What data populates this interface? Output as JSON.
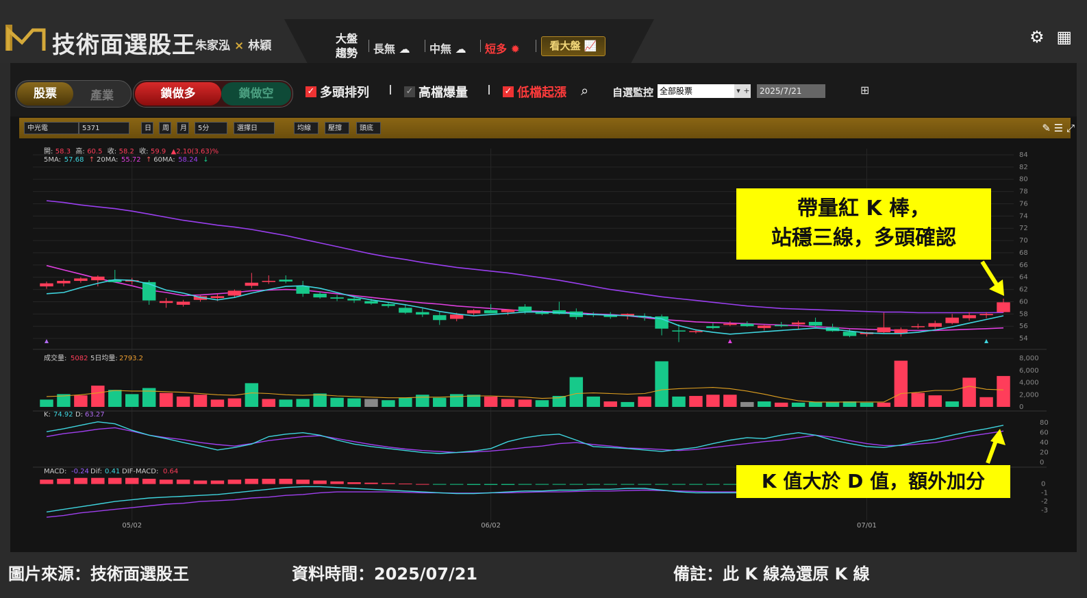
{
  "app": {
    "title": "技術面選股王",
    "author1": "朱家泓",
    "author_sep": "×",
    "author2": "林穎"
  },
  "market": {
    "label_line1": "大盤",
    "label_line2": "趨勢",
    "long": "長無",
    "mid": "中無",
    "short": "短多",
    "button": "看大盤"
  },
  "toolbar": {
    "seg1": [
      "股票",
      "產業"
    ],
    "seg2": [
      "鎖做多",
      "鎖做空"
    ],
    "filters": [
      {
        "label": "多頭排列",
        "checked": true
      },
      {
        "label": "高檔爆量",
        "checked": false
      },
      {
        "label": "低檔起漲",
        "checked": true
      }
    ],
    "watch_label": "自選監控",
    "watch_value": "全部股票",
    "date_value": "2025/7/21"
  },
  "chart_toolbar": {
    "stock_name": "中光電",
    "stock_code": "5371",
    "periods": [
      "日",
      "周",
      "月"
    ],
    "interval": "5分",
    "option": "選擇日",
    "tools": [
      "均線",
      "壓撐",
      "頭底"
    ]
  },
  "info": {
    "o_label": "開:",
    "o": "58.3",
    "h_label": "高:",
    "h": "60.5",
    "l_label": "收:",
    "l": "58.2",
    "c_label": "收:",
    "c": "59.9",
    "chg": "▲2.10(3.63)%",
    "ma5_label": "5MA:",
    "ma5": "57.68",
    "ma20_label": "20MA:",
    "ma20": "55.72",
    "ma60_label": "60MA:",
    "ma60": "58.24",
    "vol_label": "成交量:",
    "vol": "5082",
    "vol5_label": "5日均量:",
    "vol5": "2793.2",
    "k_label": "K:",
    "k": "74.92",
    "d_label": "D:",
    "d": "63.27",
    "macd_label": "MACD:",
    "macd": "-0.24",
    "dif_label": "Dif:",
    "dif": "0.41",
    "difmacd_label": "DIF-MACD:",
    "difmacd": "0.64"
  },
  "colors": {
    "up": "#ff3d5a",
    "down": "#17c98a",
    "ma5": "#3fd6e0",
    "ma20": "#e040e0",
    "ma60": "#9a3ff0",
    "callout": "#ffff00"
  },
  "chart_data": {
    "type": "candlestick",
    "x_ticks": [
      "05/02",
      "06/02",
      "07/01"
    ],
    "price_axis": [
      "84",
      "82",
      "80",
      "78",
      "76",
      "74",
      "72",
      "70",
      "68",
      "66",
      "64",
      "62",
      "60",
      "58",
      "56",
      "54"
    ],
    "price_range": [
      53,
      85
    ],
    "volume_axis": [
      "8,000",
      "6,000",
      "4,000",
      "2,000",
      "0"
    ],
    "volume_range": [
      0,
      8000
    ],
    "kd_axis": [
      "80",
      "60",
      "40",
      "20",
      "0"
    ],
    "macd_axis": [
      "0",
      "-1",
      "-2",
      "-3"
    ],
    "candles": [
      [
        62.5,
        63.3,
        62.1,
        63.0
      ],
      [
        63.0,
        63.7,
        62.5,
        63.4
      ],
      [
        63.4,
        64.0,
        63.1,
        63.8
      ],
      [
        63.5,
        64.3,
        62.5,
        64.1
      ],
      [
        63.6,
        65.2,
        63.1,
        63.2
      ],
      [
        63.3,
        63.9,
        62.8,
        63.5
      ],
      [
        63.2,
        63.5,
        59.5,
        60.2
      ],
      [
        59.8,
        60.6,
        59.0,
        60.1
      ],
      [
        59.5,
        60.3,
        59.2,
        60.0
      ],
      [
        60.3,
        61.0,
        60.0,
        60.9
      ],
      [
        60.6,
        61.3,
        60.1,
        60.9
      ],
      [
        61.0,
        62.0,
        60.7,
        61.8
      ],
      [
        62.6,
        64.7,
        62.2,
        63.1
      ],
      [
        63.3,
        64.3,
        62.9,
        63.4
      ],
      [
        63.6,
        64.3,
        63.0,
        63.3
      ],
      [
        62.5,
        63.4,
        60.8,
        61.3
      ],
      [
        61.3,
        61.6,
        60.5,
        60.7
      ],
      [
        60.7,
        61.1,
        60.1,
        60.5
      ],
      [
        60.5,
        60.9,
        59.8,
        60.2
      ],
      [
        60.1,
        60.5,
        59.5,
        59.7
      ],
      [
        59.6,
        60.0,
        59.0,
        59.3
      ],
      [
        59.0,
        59.5,
        58.0,
        58.2
      ],
      [
        58.3,
        58.9,
        57.5,
        57.9
      ],
      [
        57.8,
        58.3,
        56.2,
        57.0
      ],
      [
        57.2,
        58.2,
        56.8,
        57.9
      ],
      [
        58.1,
        58.8,
        57.8,
        58.6
      ],
      [
        58.6,
        59.6,
        58.1,
        58.1
      ],
      [
        58.3,
        58.8,
        57.8,
        58.7
      ],
      [
        59.2,
        59.6,
        58.0,
        58.4
      ],
      [
        58.2,
        58.6,
        57.8,
        58.0
      ],
      [
        58.6,
        60.0,
        57.9,
        58.0
      ],
      [
        58.4,
        58.9,
        57.1,
        57.5
      ],
      [
        58.0,
        58.3,
        57.5,
        57.8
      ],
      [
        57.8,
        58.3,
        57.2,
        57.5
      ],
      [
        57.7,
        58.1,
        57.1,
        58.0
      ],
      [
        57.6,
        58.1,
        56.9,
        57.5
      ],
      [
        57.6,
        57.9,
        54.5,
        55.6
      ],
      [
        55.3,
        56.3,
        53.4,
        55.2
      ],
      [
        55.1,
        55.5,
        54.8,
        55.2
      ],
      [
        56.0,
        56.5,
        55.5,
        55.7
      ],
      [
        56.2,
        56.8,
        56.0,
        56.4
      ],
      [
        56.4,
        56.8,
        55.9,
        56.0
      ],
      [
        55.7,
        56.2,
        55.3,
        56.1
      ],
      [
        56.2,
        56.7,
        55.8,
        56.0
      ],
      [
        56.3,
        56.9,
        55.4,
        56.6
      ],
      [
        56.7,
        57.4,
        55.8,
        56.1
      ],
      [
        55.8,
        56.4,
        55.1,
        55.2
      ],
      [
        55.1,
        55.5,
        54.2,
        54.4
      ],
      [
        54.7,
        55.1,
        54.3,
        55.0
      ],
      [
        55.0,
        58.2,
        54.9,
        55.8
      ],
      [
        54.8,
        55.8,
        54.3,
        55.5
      ],
      [
        56.0,
        56.4,
        55.6,
        56.0
      ],
      [
        55.9,
        56.9,
        55.5,
        56.5
      ],
      [
        56.5,
        58.0,
        56.3,
        57.4
      ],
      [
        57.3,
        58.3,
        56.9,
        57.8
      ],
      [
        57.8,
        58.3,
        57.3,
        58.0
      ],
      [
        58.3,
        60.5,
        58.2,
        59.9
      ]
    ],
    "volume": [
      [
        1200,
        "d"
      ],
      [
        2100,
        "d"
      ],
      [
        1900,
        "u"
      ],
      [
        3500,
        "u"
      ],
      [
        2800,
        "d"
      ],
      [
        2100,
        "d"
      ],
      [
        3100,
        "d"
      ],
      [
        2300,
        "u"
      ],
      [
        1700,
        "u"
      ],
      [
        2000,
        "u"
      ],
      [
        1200,
        "u"
      ],
      [
        1400,
        "u"
      ],
      [
        3900,
        "d"
      ],
      [
        1300,
        "u"
      ],
      [
        1200,
        "d"
      ],
      [
        1300,
        "d"
      ],
      [
        2200,
        "d"
      ],
      [
        1500,
        "d"
      ],
      [
        1400,
        "d"
      ],
      [
        1300,
        "g"
      ],
      [
        1100,
        "d"
      ],
      [
        1500,
        "d"
      ],
      [
        2000,
        "d"
      ],
      [
        1500,
        "d"
      ],
      [
        2100,
        "d"
      ],
      [
        2000,
        "d"
      ],
      [
        1700,
        "u"
      ],
      [
        1300,
        "u"
      ],
      [
        1200,
        "u"
      ],
      [
        1100,
        "d"
      ],
      [
        1800,
        "d"
      ],
      [
        4900,
        "d"
      ],
      [
        1700,
        "d"
      ],
      [
        900,
        "u"
      ],
      [
        800,
        "d"
      ],
      [
        1700,
        "u"
      ],
      [
        7500,
        "d"
      ],
      [
        1700,
        "d"
      ],
      [
        1800,
        "u"
      ],
      [
        2000,
        "u"
      ],
      [
        2000,
        "u"
      ],
      [
        800,
        "g"
      ],
      [
        900,
        "d"
      ],
      [
        700,
        "u"
      ],
      [
        700,
        "d"
      ],
      [
        800,
        "d"
      ],
      [
        800,
        "d"
      ],
      [
        900,
        "d"
      ],
      [
        700,
        "d"
      ],
      [
        700,
        "u"
      ],
      [
        7600,
        "u"
      ],
      [
        2300,
        "u"
      ],
      [
        1900,
        "u"
      ],
      [
        900,
        "d"
      ],
      [
        4800,
        "u"
      ],
      [
        1600,
        "u"
      ],
      [
        5082,
        "u"
      ]
    ],
    "ma5": [
      61.3,
      61.5,
      62.3,
      63.0,
      63.6,
      63.5,
      62.9,
      61.9,
      61.4,
      60.7,
      60.3,
      60.7,
      61.4,
      62.0,
      62.5,
      62.6,
      62.2,
      61.5,
      60.8,
      60.3,
      59.9,
      59.5,
      59.0,
      58.4,
      58.0,
      57.7,
      57.9,
      58.1,
      58.3,
      58.3,
      58.2,
      58.0,
      57.9,
      57.8,
      57.7,
      57.6,
      57.2,
      56.1,
      55.4,
      55.0,
      54.7,
      54.9,
      55.1,
      55.3,
      55.5,
      55.7,
      55.5,
      55.2,
      54.9,
      54.8,
      54.8,
      55.0,
      55.4,
      55.9,
      56.5,
      57.1,
      57.7
    ],
    "ma20": [
      65.9,
      65.2,
      64.5,
      63.8,
      63.2,
      62.6,
      61.9,
      61.5,
      61.0,
      61.1,
      61.3,
      61.5,
      61.8,
      61.9,
      62.0,
      61.9,
      61.6,
      61.3,
      61.0,
      60.7,
      60.4,
      60.1,
      59.8,
      59.6,
      59.3,
      59.1,
      58.9,
      58.7,
      58.5,
      58.4,
      58.3,
      58.2,
      58.0,
      57.9,
      57.7,
      57.4,
      57.1,
      56.9,
      56.7,
      56.6,
      56.5,
      56.4,
      56.3,
      56.2,
      56.1,
      55.9,
      55.8,
      55.6,
      55.5,
      55.4,
      55.3,
      55.3,
      55.3,
      55.4,
      55.5,
      55.6,
      55.72
    ],
    "ma60": [
      76.5,
      76.2,
      75.8,
      75.5,
      75.2,
      74.8,
      74.3,
      73.8,
      73.3,
      72.9,
      72.5,
      72.2,
      71.8,
      71.3,
      70.8,
      70.2,
      69.6,
      69.0,
      68.4,
      67.8,
      67.3,
      66.9,
      66.4,
      66.0,
      65.6,
      65.3,
      65.0,
      64.7,
      64.3,
      63.9,
      63.5,
      63.0,
      62.5,
      62.0,
      61.6,
      61.2,
      60.8,
      60.5,
      60.2,
      59.9,
      59.6,
      59.3,
      59.1,
      58.9,
      58.8,
      58.7,
      58.6,
      58.5,
      58.4,
      58.3,
      58.3,
      58.2,
      58.2,
      58.2,
      58.2,
      58.2,
      58.24
    ],
    "k": [
      62,
      68,
      75,
      82,
      78,
      65,
      55,
      48,
      40,
      33,
      25,
      30,
      37,
      52,
      57,
      60,
      55,
      45,
      37,
      32,
      28,
      24,
      20,
      18,
      20,
      23,
      28,
      42,
      50,
      55,
      57,
      45,
      32,
      30,
      28,
      25,
      22,
      26,
      30,
      38,
      45,
      50,
      48,
      55,
      60,
      55,
      45,
      38,
      32,
      30,
      35,
      42,
      47,
      55,
      62,
      68,
      75
    ],
    "d": [
      52,
      58,
      62,
      67,
      70,
      63,
      55,
      50,
      46,
      40,
      36,
      33,
      38,
      44,
      48,
      52,
      54,
      48,
      42,
      36,
      31,
      27,
      24,
      22,
      20,
      21,
      23,
      26,
      30,
      33,
      38,
      40,
      36,
      33,
      29,
      28,
      26,
      24,
      26,
      30,
      34,
      38,
      42,
      45,
      50,
      55,
      51,
      44,
      38,
      34,
      34,
      37,
      40,
      46,
      53,
      58,
      63.27
    ],
    "macd_hist": [
      0.5,
      0.6,
      0.7,
      0.7,
      0.7,
      0.7,
      0.6,
      0.5,
      0.5,
      0.4,
      0.4,
      0.5,
      0.6,
      0.6,
      0.6,
      0.5,
      0.4,
      0.3,
      0.2,
      0.15,
      0.1,
      0.05,
      0,
      -0.05,
      -0.08,
      -0.1,
      -0.1,
      -0.1,
      -0.08,
      -0.06,
      -0.05,
      -0.05,
      -0.04,
      -0.03,
      -0.02,
      -0.02,
      -0.04,
      -0.06,
      -0.08,
      -0.08,
      -0.08,
      -0.08,
      -0.06,
      -0.05,
      -0.04,
      -0.03,
      -0.02,
      -0.01,
      0,
      0.02,
      0.04,
      0.06,
      0.08,
      0.1,
      0.12,
      0.13,
      0.14
    ],
    "dif": [
      -3.2,
      -2.9,
      -2.6,
      -2.3,
      -2.0,
      -1.8,
      -1.6,
      -1.5,
      -1.4,
      -1.3,
      -1.2,
      -1.0,
      -0.8,
      -0.6,
      -0.4,
      -0.3,
      -0.3,
      -0.4,
      -0.5,
      -0.6,
      -0.7,
      -0.8,
      -0.9,
      -1.0,
      -1.1,
      -1.1,
      -1.0,
      -0.9,
      -0.8,
      -0.8,
      -0.7,
      -0.7,
      -0.6,
      -0.6,
      -0.5,
      -0.5,
      -0.7,
      -0.9,
      -1.0,
      -1.0,
      -1.0,
      -1.0,
      -0.9,
      -0.9,
      -0.8,
      -0.8,
      -0.8,
      -0.8,
      -0.7,
      -0.6,
      -0.4,
      -0.3,
      -0.2,
      0.0,
      0.2,
      0.3,
      0.41
    ],
    "macd": [
      -3.8,
      -3.6,
      -3.3,
      -3.1,
      -2.9,
      -2.7,
      -2.5,
      -2.3,
      -2.2,
      -2.0,
      -1.9,
      -1.8,
      -1.6,
      -1.5,
      -1.3,
      -1.2,
      -1.0,
      -0.9,
      -0.9,
      -0.9,
      -0.9,
      -0.95,
      -1.0,
      -1.0,
      -1.05,
      -1.05,
      -1.0,
      -1.0,
      -0.95,
      -0.9,
      -0.9,
      -0.85,
      -0.8,
      -0.8,
      -0.75,
      -0.7,
      -0.75,
      -0.8,
      -0.85,
      -0.9,
      -0.9,
      -0.9,
      -0.9,
      -0.85,
      -0.85,
      -0.8,
      -0.8,
      -0.8,
      -0.75,
      -0.7,
      -0.6,
      -0.5,
      -0.45,
      -0.4,
      -0.35,
      -0.3,
      -0.24
    ],
    "vol_ma5": [
      1700,
      1800,
      2000,
      2300,
      2700,
      2600,
      2600,
      2500,
      2400,
      2200,
      2000,
      1900,
      2300,
      2200,
      2000,
      1900,
      2000,
      1800,
      1700,
      1600,
      1500,
      1500,
      1600,
      1600,
      1700,
      1800,
      1800,
      1700,
      1600,
      1400,
      1500,
      2200,
      2300,
      2200,
      2100,
      2200,
      2800,
      3000,
      3100,
      3200,
      3000,
      2600,
      2100,
      1500,
      1000,
      800,
      800,
      800,
      800,
      800,
      2200,
      2400,
      2700,
      2700,
      3400,
      2900,
      2793.2
    ]
  },
  "callouts": {
    "line1": "帶量紅 K 棒，",
    "line2": "站穩三線，多頭確認",
    "kd": "K 值大於 D 值，額外加分"
  },
  "footer": {
    "source": "圖片來源：技術面選股王",
    "date": "資料時間：2025/07/21",
    "note": "備註：此 K 線為還原 K 線"
  }
}
